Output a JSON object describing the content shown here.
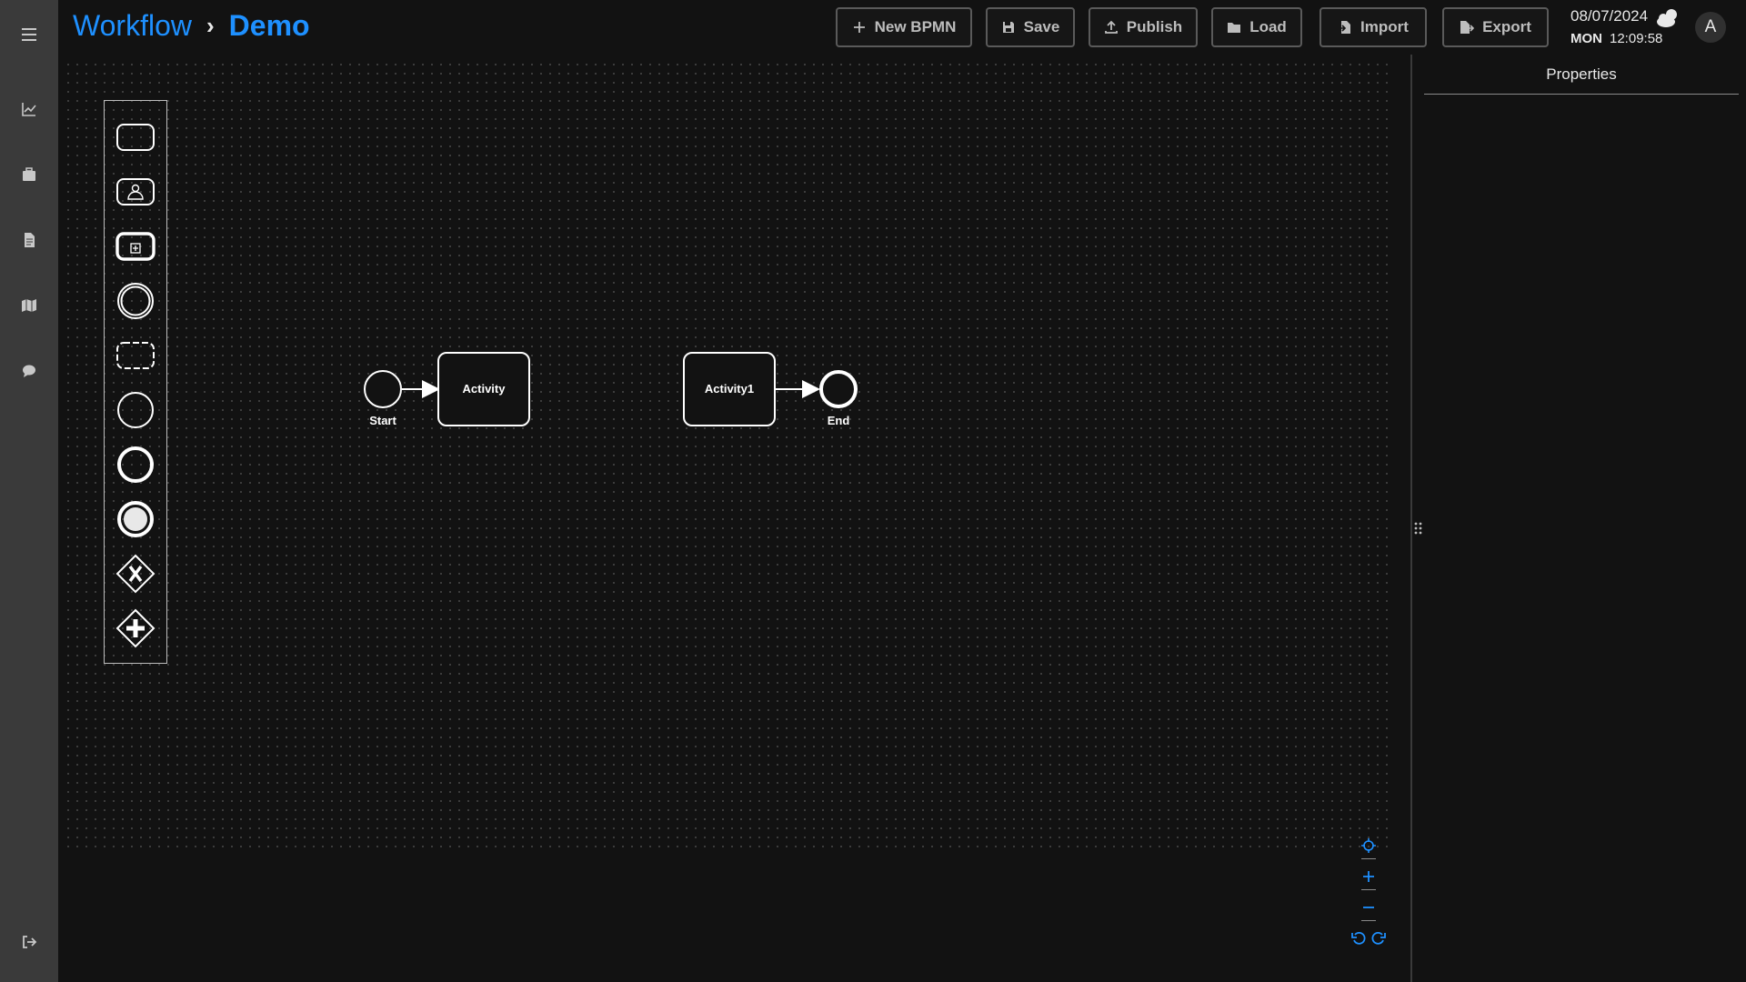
{
  "breadcrumb": {
    "root": "Workflow",
    "separator": "›",
    "current": "Demo"
  },
  "toolbar": {
    "buttons": [
      {
        "id": "new",
        "label": "New BPMN",
        "icon": "plus-icon"
      },
      {
        "id": "save",
        "label": "Save",
        "icon": "floppy-icon"
      },
      {
        "id": "publish",
        "label": "Publish",
        "icon": "upload-icon"
      },
      {
        "id": "load",
        "label": "Load",
        "icon": "folder-icon"
      },
      {
        "id": "import",
        "label": "Import",
        "icon": "file-import-icon"
      },
      {
        "id": "export",
        "label": "Export",
        "icon": "file-export-icon"
      }
    ]
  },
  "datetime": {
    "date": "08/07/2024",
    "day": "MON",
    "time": "12:09:58"
  },
  "user": {
    "avatar_letter": "A"
  },
  "sidebar": {
    "items": [
      {
        "id": "menu",
        "icon": "hamburger-menu-icon"
      },
      {
        "id": "analytics",
        "icon": "line-chart-icon"
      },
      {
        "id": "portfolio",
        "icon": "briefcase-icon"
      },
      {
        "id": "documents",
        "icon": "document-icon"
      },
      {
        "id": "map",
        "icon": "map-icon"
      },
      {
        "id": "chat",
        "icon": "chat-bubble-icon"
      },
      {
        "id": "logout",
        "icon": "logout-icon"
      }
    ]
  },
  "palette": {
    "items": [
      {
        "id": "task",
        "icon": "task-icon"
      },
      {
        "id": "user-task",
        "icon": "user-task-icon"
      },
      {
        "id": "subprocess",
        "icon": "subprocess-icon"
      },
      {
        "id": "intermediate-event",
        "icon": "intermediate-event-icon"
      },
      {
        "id": "group",
        "icon": "group-icon"
      },
      {
        "id": "start-event",
        "icon": "start-event-icon"
      },
      {
        "id": "end-event",
        "icon": "end-event-icon"
      },
      {
        "id": "terminate-event",
        "icon": "terminate-event-icon"
      },
      {
        "id": "exclusive-gateway",
        "icon": "exclusive-gateway-icon"
      },
      {
        "id": "parallel-gateway",
        "icon": "parallel-gateway-icon"
      }
    ]
  },
  "diagram": {
    "nodes": [
      {
        "id": "start",
        "type": "start-event",
        "label": "Start"
      },
      {
        "id": "activity",
        "type": "task",
        "label": "Activity"
      },
      {
        "id": "activity1",
        "type": "task",
        "label": "Activity1"
      },
      {
        "id": "end",
        "type": "end-event",
        "label": "End"
      }
    ],
    "flows": [
      {
        "from": "start",
        "to": "activity"
      },
      {
        "from": "activity1",
        "to": "end"
      }
    ]
  },
  "properties": {
    "title": "Properties"
  },
  "zoom_controls": [
    {
      "id": "fit",
      "icon": "crosshair-icon"
    },
    {
      "id": "zoom-in",
      "icon": "plus-icon"
    },
    {
      "id": "zoom-out",
      "icon": "minus-icon"
    },
    {
      "id": "undo",
      "icon": "undo-icon"
    },
    {
      "id": "redo",
      "icon": "redo-icon"
    }
  ],
  "colors": {
    "accent": "#1e90ff",
    "background": "#121212",
    "sidebar": "#3a3a3a",
    "node_stroke": "#ffffff"
  }
}
